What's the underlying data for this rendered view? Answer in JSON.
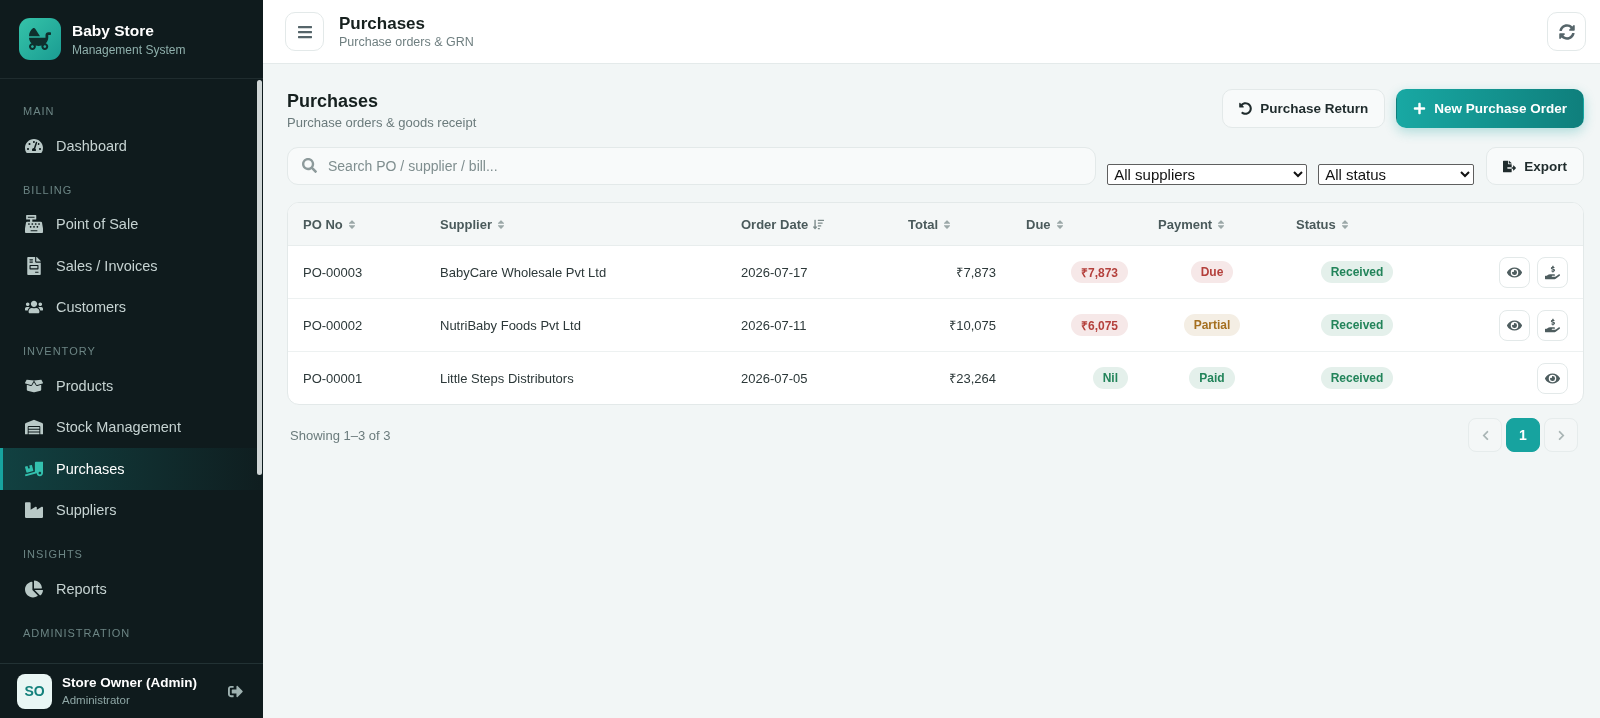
{
  "sidebar": {
    "brand": {
      "name": "Baby Store",
      "tagline": "Management System"
    },
    "sections": [
      {
        "label": "MAIN",
        "items": [
          {
            "label": "Dashboard",
            "selected": false
          }
        ]
      },
      {
        "label": "BILLING",
        "items": [
          {
            "label": "Point of Sale",
            "selected": false
          },
          {
            "label": "Sales / Invoices",
            "selected": false
          },
          {
            "label": "Customers",
            "selected": false
          }
        ]
      },
      {
        "label": "INVENTORY",
        "items": [
          {
            "label": "Products",
            "selected": false
          },
          {
            "label": "Stock Management",
            "selected": false
          },
          {
            "label": "Purchases",
            "selected": true
          },
          {
            "label": "Suppliers",
            "selected": false
          }
        ]
      },
      {
        "label": "INSIGHTS",
        "items": [
          {
            "label": "Reports",
            "selected": false
          }
        ]
      },
      {
        "label": "ADMINISTRATION"
      }
    ],
    "user": {
      "initials": "SO",
      "name": "Store Owner (Admin)",
      "role": "Administrator"
    }
  },
  "header": {
    "title": "Purchases",
    "subtitle": "Purchase orders & GRN"
  },
  "page": {
    "title": "Purchases",
    "subtitle": "Purchase orders & goods receipt",
    "actions": [
      {
        "label": "Purchase Return",
        "kind": "secondary"
      },
      {
        "label": "New Purchase Order",
        "kind": "primary"
      }
    ]
  },
  "filters": {
    "search": {
      "placeholder": "Search PO / supplier / bill..."
    },
    "selects": [
      {
        "value": "All suppliers"
      },
      {
        "value": "All status"
      }
    ],
    "export": {
      "label": "Export"
    }
  },
  "table": {
    "columns": [
      {
        "label": "PO No",
        "sorted": false
      },
      {
        "label": "Supplier",
        "sorted": false
      },
      {
        "label": "Order Date",
        "sorted": true
      },
      {
        "label": "Total",
        "sorted": false
      },
      {
        "label": "Due",
        "sorted": false
      },
      {
        "label": "Payment",
        "sorted": false
      },
      {
        "label": "Status",
        "sorted": false
      }
    ],
    "rows": [
      {
        "po": "PO-00003",
        "supplier": "BabyCare Wholesale Pvt Ltd",
        "date": "2026-07-17",
        "total": "₹7,873",
        "due": {
          "text": "₹7,873",
          "color": "#b4403c"
        },
        "payment": {
          "text": "Due",
          "color": "#b4403c"
        },
        "status": {
          "text": "Received",
          "color": "#22845a"
        },
        "payable": true
      },
      {
        "po": "PO-00002",
        "supplier": "NutriBaby Foods Pvt Ltd",
        "date": "2026-07-11",
        "total": "₹10,075",
        "due": {
          "text": "₹6,075",
          "color": "#b4403c"
        },
        "payment": {
          "text": "Partial",
          "color": "#a56f1f"
        },
        "status": {
          "text": "Received",
          "color": "#22845a"
        },
        "payable": true
      },
      {
        "po": "PO-00001",
        "supplier": "Little Steps Distributors",
        "date": "2026-07-05",
        "total": "₹23,264",
        "due": {
          "text": "Nil",
          "color": "#22845a"
        },
        "payment": {
          "text": "Paid",
          "color": "#22845a"
        },
        "status": {
          "text": "Received",
          "color": "#22845a"
        },
        "payable": false
      }
    ]
  },
  "pagination": {
    "summary": "Showing 1–3 of 3",
    "previous_disabled": true,
    "next_disabled": true,
    "pages": [
      {
        "label": "1",
        "selected": true
      }
    ]
  }
}
